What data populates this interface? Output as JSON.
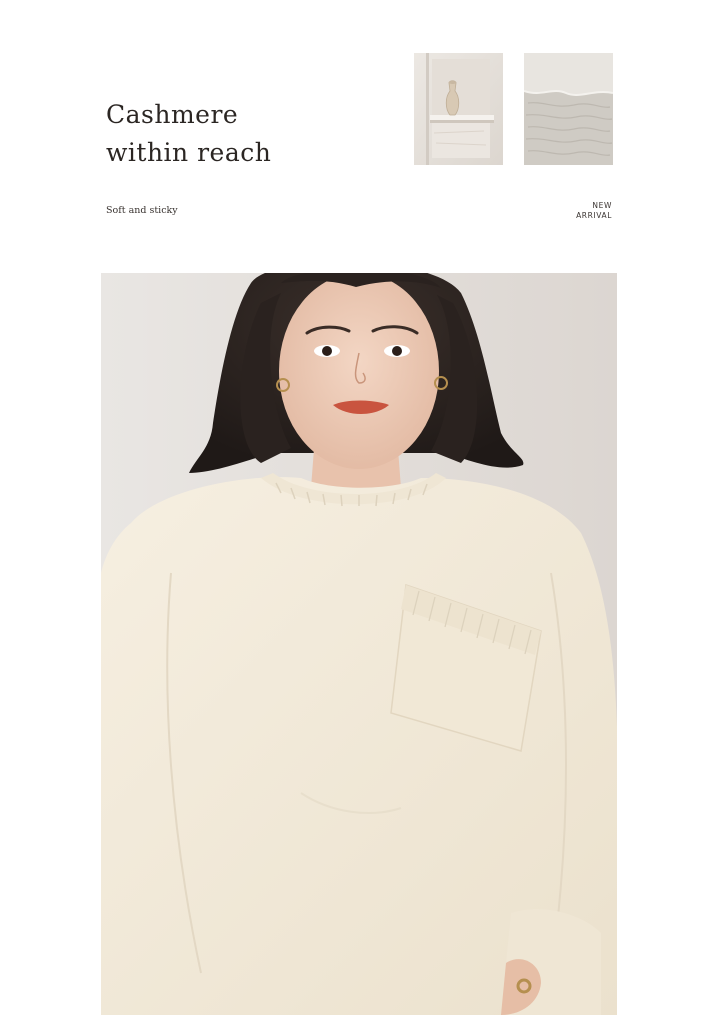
{
  "headline": {
    "line1": "Cashmere",
    "line2": "within reach"
  },
  "tagline": "Soft and sticky",
  "badge": {
    "line1": "NEW",
    "line2": "ARRIVAL"
  },
  "images": {
    "thumb_shelf": "shelf-vase",
    "thumb_fabric": "knit-texture",
    "hero": "model-sweater"
  },
  "colors": {
    "text": "#2b2623",
    "sweater": "#f2ead9",
    "background": "#e6e2de"
  }
}
